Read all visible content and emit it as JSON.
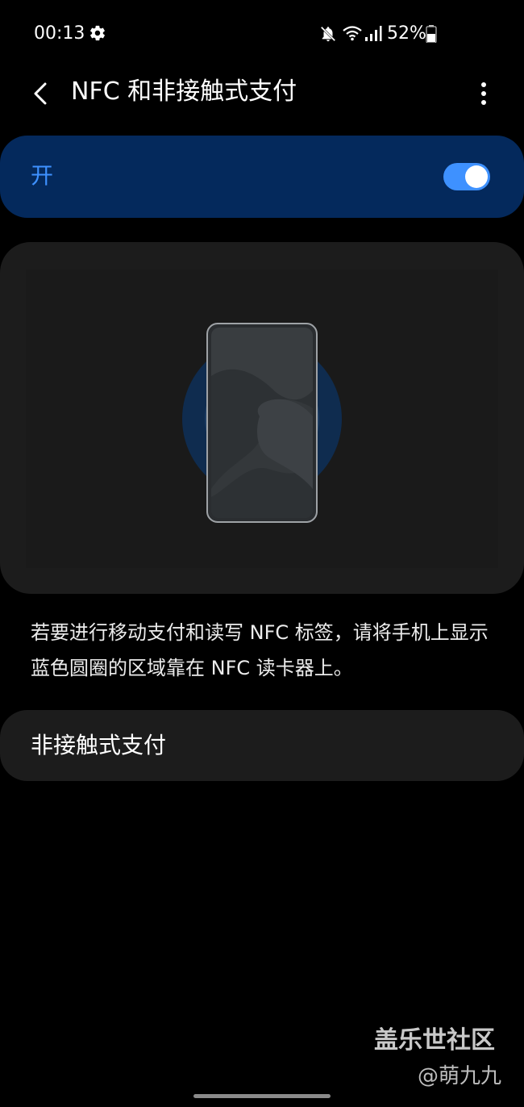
{
  "status_bar": {
    "time": "00:13",
    "battery_percent": "52%",
    "icons": [
      "settings-gear-icon",
      "mute-icon",
      "wifi-icon",
      "signal-icon",
      "battery-icon"
    ]
  },
  "header": {
    "title": "NFC 和非接触式支付",
    "back_icon": "chevron-left-icon",
    "more_icon": "more-vert-icon"
  },
  "master_switch": {
    "label": "开",
    "state": "on"
  },
  "description": "若要进行移动支付和读写 NFC 标签，请将手机上显示蓝色圆圈的区域靠在 NFC 读卡器上。",
  "list": {
    "contactless_payment_label": "非接触式支付"
  },
  "watermark": {
    "brand": "盖乐世社区",
    "user": "@萌九九"
  },
  "colors": {
    "background": "#000000",
    "accent": "#3e91ff",
    "switch_card": "#04295c",
    "card": "#1c1c1c"
  }
}
